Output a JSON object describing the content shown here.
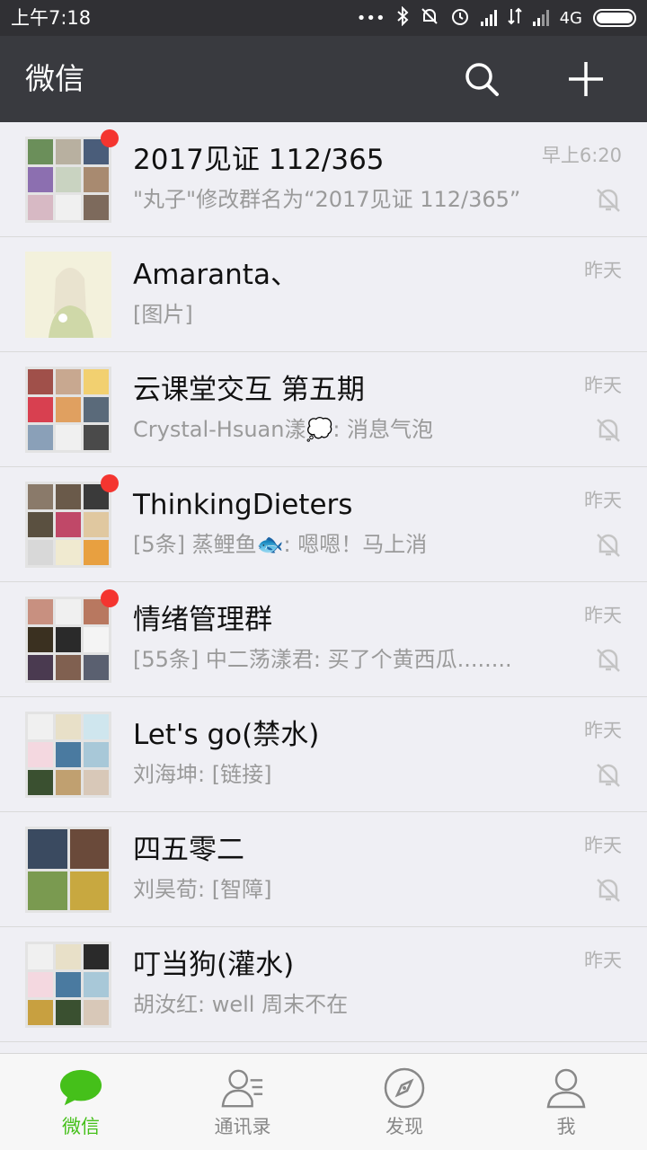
{
  "status_bar": {
    "time": "上午7:18",
    "network": "4G"
  },
  "header": {
    "title": "微信",
    "search_icon": "search-icon",
    "add_icon": "plus-icon"
  },
  "colors": {
    "header_bg": "#393a3f",
    "accent_green": "#45c01a",
    "unread_red": "#f43530"
  },
  "chats": [
    {
      "name": "2017见证 112/365",
      "preview": "\"丸子\"修改群名为“2017见证 112/365”",
      "time": "早上6:20",
      "unread": true,
      "muted": true
    },
    {
      "name": "Amaranta、",
      "preview": "[图片]",
      "time": "昨天",
      "unread": false,
      "muted": false
    },
    {
      "name": "云课堂交互 第五期",
      "preview": "Crystal-Hsuan漾💭: 消息气泡",
      "time": "昨天",
      "unread": false,
      "muted": true
    },
    {
      "name": "ThinkingDieters",
      "preview": "[5条] 蒸鲤鱼🐟: 嗯嗯！马上消",
      "time": "昨天",
      "unread": true,
      "muted": true
    },
    {
      "name": "情绪管理群",
      "preview": "[55条] 中二荡漾君: 买了个黄西瓜........",
      "time": "昨天",
      "unread": true,
      "muted": true
    },
    {
      "name": "Let's go(禁水)",
      "preview": "刘海坤: [链接]",
      "time": "昨天",
      "unread": false,
      "muted": true
    },
    {
      "name": "四五零二",
      "preview": "刘昊荀: [智障]",
      "time": "昨天",
      "unread": false,
      "muted": true
    },
    {
      "name": "叮当狗(灌水)",
      "preview": "胡汝红: well 周末不在",
      "time": "昨天",
      "unread": false,
      "muted": false
    }
  ],
  "tabs": [
    {
      "label": "微信",
      "icon": "chat-bubble-icon",
      "active": true
    },
    {
      "label": "通讯录",
      "icon": "contacts-icon",
      "active": false
    },
    {
      "label": "发现",
      "icon": "compass-icon",
      "active": false
    },
    {
      "label": "我",
      "icon": "person-icon",
      "active": false
    }
  ]
}
